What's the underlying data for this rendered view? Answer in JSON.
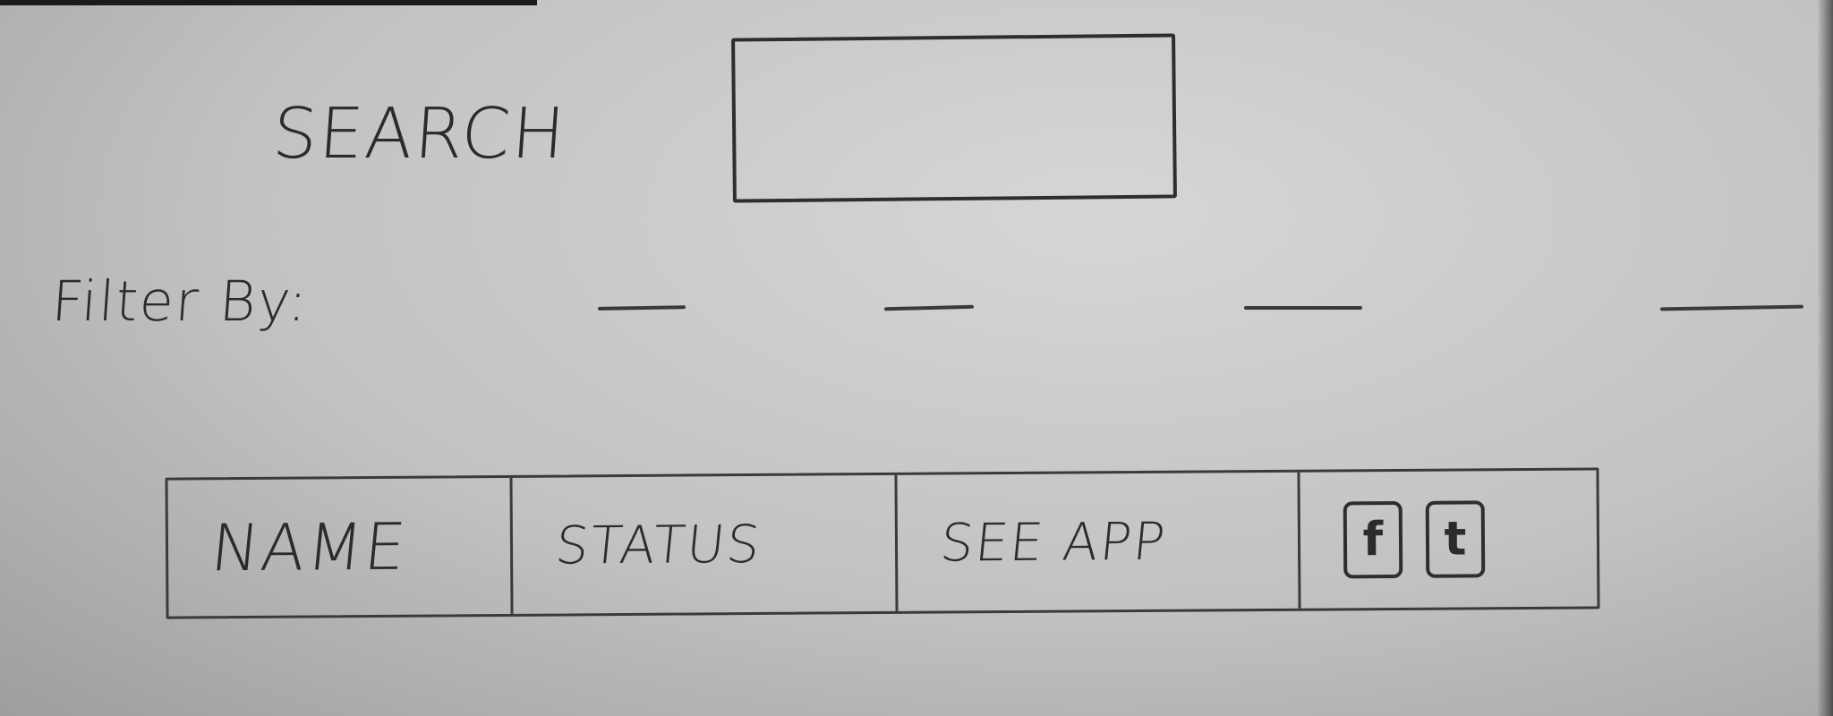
{
  "search": {
    "label": "SEARCH",
    "value": "",
    "placeholder": ""
  },
  "filter": {
    "label": "Filter By:",
    "options": [
      "",
      "",
      "",
      ""
    ]
  },
  "table": {
    "columns": [
      "NAME",
      "STATUS",
      "SEE APP"
    ],
    "social_icons": [
      {
        "icon": "facebook-icon",
        "glyph": "f"
      },
      {
        "icon": "twitter-icon",
        "glyph": "t"
      }
    ]
  }
}
